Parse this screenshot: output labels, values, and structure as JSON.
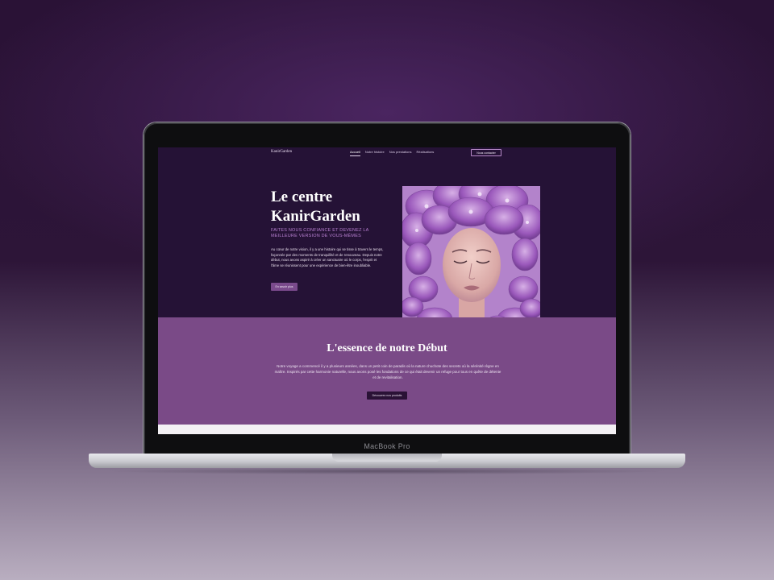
{
  "device": {
    "model_label": "MacBook Pro"
  },
  "nav": {
    "logo": "KanirGarden",
    "links": [
      "Accueil",
      "Notre histoire",
      "Nos prestations",
      "Réalisations"
    ],
    "cta": "Nous contacter"
  },
  "hero": {
    "title_line1": "Le centre",
    "title_line2": "KanirGarden",
    "subtitle": "FAITES NOUS CONFIANCE ET DEVENEZ LA MEILLEURE VERSION DE VOUS-MÊMES",
    "text": "Au cœur de notre vision, il y a une histoire qui se tisse à travers le temps, façonnée par des moments de tranquillité et de renouveau. Depuis notre début, nous avons aspiré à créer un sanctuaire où le corps, l'esprit et l'âme se réunissent pour une expérience de bien-être inoubliable.",
    "button": "En savoir plus",
    "image_alt": "woman with purple flowers"
  },
  "essence": {
    "title": "L'essence de notre Début",
    "text": "Notre voyage a commencé il y a plusieurs années, dans un petit coin de paradis où la nature chuchote des secrets où la sérénité règne en maître. Inspirés par cette harmonie naturelle, nous avons posé les fondations de ce qui était devenir un refuge pour tous en quête de détente et de revitalisation.",
    "button": "Découvrez nos produits"
  },
  "colors": {
    "hero_bg": "#251236",
    "essence_bg": "#7a4a87",
    "accent": "#b77fd0"
  }
}
